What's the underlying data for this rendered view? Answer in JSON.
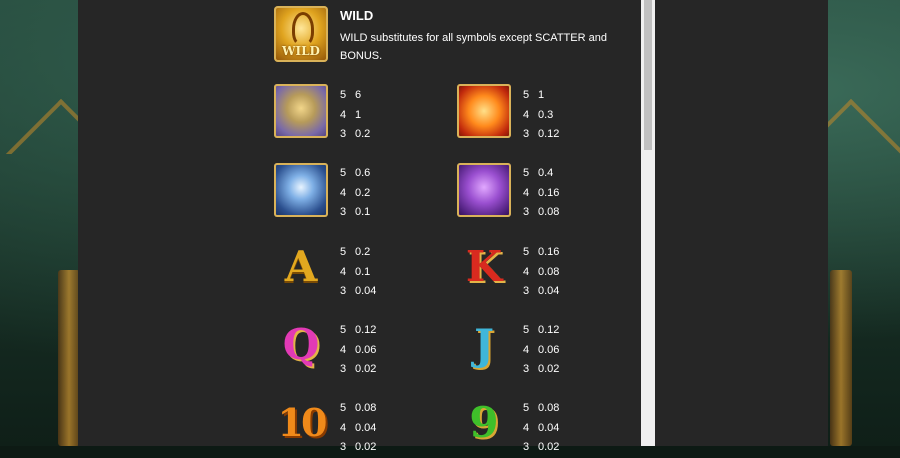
{
  "wild": {
    "title": "WILD",
    "icon_text": "WILD",
    "description": "WILD substitutes for all symbols except SCATTER and BONUS."
  },
  "paytable": [
    {
      "symbol": "dragon-icon",
      "pays": [
        {
          "count": "5",
          "value": "6"
        },
        {
          "count": "4",
          "value": "1"
        },
        {
          "count": "3",
          "value": "0.2"
        }
      ]
    },
    {
      "symbol": "phoenix-icon",
      "pays": [
        {
          "count": "5",
          "value": "1"
        },
        {
          "count": "4",
          "value": "0.3"
        },
        {
          "count": "3",
          "value": "0.12"
        }
      ]
    },
    {
      "symbol": "tiger-icon",
      "pays": [
        {
          "count": "5",
          "value": "0.6"
        },
        {
          "count": "4",
          "value": "0.2"
        },
        {
          "count": "3",
          "value": "0.1"
        }
      ]
    },
    {
      "symbol": "turtle-icon",
      "pays": [
        {
          "count": "5",
          "value": "0.4"
        },
        {
          "count": "4",
          "value": "0.16"
        },
        {
          "count": "3",
          "value": "0.08"
        }
      ]
    },
    {
      "symbol": "A",
      "pays": [
        {
          "count": "5",
          "value": "0.2"
        },
        {
          "count": "4",
          "value": "0.1"
        },
        {
          "count": "3",
          "value": "0.04"
        }
      ]
    },
    {
      "symbol": "K",
      "pays": [
        {
          "count": "5",
          "value": "0.16"
        },
        {
          "count": "4",
          "value": "0.08"
        },
        {
          "count": "3",
          "value": "0.04"
        }
      ]
    },
    {
      "symbol": "Q",
      "pays": [
        {
          "count": "5",
          "value": "0.12"
        },
        {
          "count": "4",
          "value": "0.06"
        },
        {
          "count": "3",
          "value": "0.02"
        }
      ]
    },
    {
      "symbol": "J",
      "pays": [
        {
          "count": "5",
          "value": "0.12"
        },
        {
          "count": "4",
          "value": "0.06"
        },
        {
          "count": "3",
          "value": "0.02"
        }
      ]
    },
    {
      "symbol": "10",
      "pays": [
        {
          "count": "5",
          "value": "0.08"
        },
        {
          "count": "4",
          "value": "0.04"
        },
        {
          "count": "3",
          "value": "0.02"
        }
      ]
    },
    {
      "symbol": "9",
      "pays": [
        {
          "count": "5",
          "value": "0.08"
        },
        {
          "count": "4",
          "value": "0.04"
        },
        {
          "count": "3",
          "value": "0.02"
        }
      ]
    }
  ],
  "colors": {
    "panel_bg": "#262626",
    "text": "#ffffff",
    "scrollbar_track": "#f0f0f0",
    "scrollbar_thumb": "#c1c1c1"
  }
}
